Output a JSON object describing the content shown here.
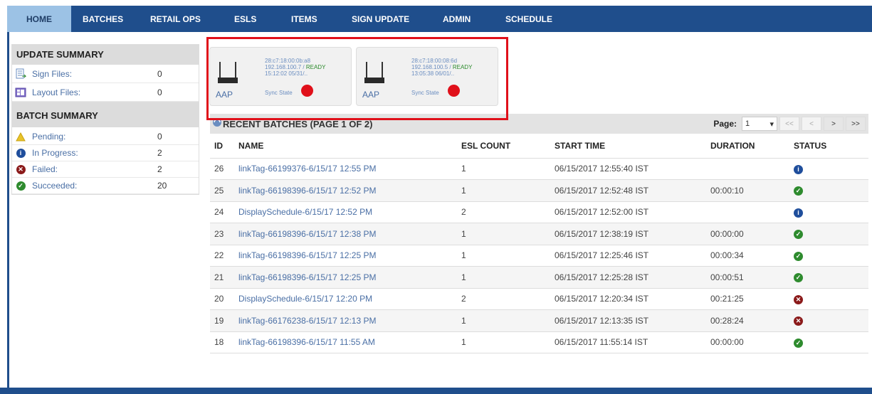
{
  "nav": {
    "items": [
      "HOME",
      "BATCHES",
      "RETAIL OPS",
      "ESLS",
      "ITEMS",
      "SIGN UPDATE",
      "ADMIN",
      "SCHEDULE"
    ],
    "active_index": 0
  },
  "update_summary": {
    "title": "UPDATE SUMMARY",
    "rows": [
      {
        "label": "Sign Files:",
        "value": "0",
        "icon": "sign-file-icon"
      },
      {
        "label": "Layout Files:",
        "value": "0",
        "icon": "layout-file-icon"
      }
    ]
  },
  "batch_summary": {
    "title": "BATCH SUMMARY",
    "rows": [
      {
        "label": "Pending:",
        "value": "0",
        "icon": "warning-icon",
        "color": "#e8c32a"
      },
      {
        "label": "In Progress:",
        "value": "2",
        "icon": "info-icon",
        "color": "#1f4e9c"
      },
      {
        "label": "Failed:",
        "value": "2",
        "icon": "error-icon",
        "color": "#8b1a1a"
      },
      {
        "label": "Succeeded:",
        "value": "20",
        "icon": "check-icon",
        "color": "#2e8b2e"
      }
    ]
  },
  "aps": [
    {
      "label": "AAP",
      "mac": "28:c7:18:00:0b:a8",
      "ip": "192.168.100.7 /",
      "status": "READY",
      "time": "15:12:02 05/31/..",
      "sync": "Sync State"
    },
    {
      "label": "AAP",
      "mac": "28:c7:18:00:08:6d",
      "ip": "192.168.100.5 /",
      "status": "READY",
      "time": "13:05:38 06/01/..",
      "sync": "Sync State"
    }
  ],
  "batches": {
    "title": "RECENT BATCHES (PAGE 1 OF 2)",
    "page_label": "Page:",
    "page_value": "1",
    "pager_buttons": [
      "<<",
      "<",
      ">",
      ">>"
    ],
    "columns": [
      "ID",
      "NAME",
      "ESL COUNT",
      "START TIME",
      "DURATION",
      "STATUS"
    ],
    "rows": [
      {
        "id": "26",
        "name": "linkTag-66199376-6/15/17 12:55 PM",
        "count": "1",
        "start": "06/15/2017 12:55:40 IST",
        "duration": "",
        "status": "info"
      },
      {
        "id": "25",
        "name": "linkTag-66198396-6/15/17 12:52 PM",
        "count": "1",
        "start": "06/15/2017 12:52:48 IST",
        "duration": "00:00:10",
        "status": "success"
      },
      {
        "id": "24",
        "name": "DisplaySchedule-6/15/17 12:52 PM",
        "count": "2",
        "start": "06/15/2017 12:52:00 IST",
        "duration": "",
        "status": "info"
      },
      {
        "id": "23",
        "name": "linkTag-66198396-6/15/17 12:38 PM",
        "count": "1",
        "start": "06/15/2017 12:38:19 IST",
        "duration": "00:00:00",
        "status": "success"
      },
      {
        "id": "22",
        "name": "linkTag-66198396-6/15/17 12:25 PM",
        "count": "1",
        "start": "06/15/2017 12:25:46 IST",
        "duration": "00:00:34",
        "status": "success"
      },
      {
        "id": "21",
        "name": "linkTag-66198396-6/15/17 12:25 PM",
        "count": "1",
        "start": "06/15/2017 12:25:28 IST",
        "duration": "00:00:51",
        "status": "success"
      },
      {
        "id": "20",
        "name": "DisplaySchedule-6/15/17 12:20 PM",
        "count": "2",
        "start": "06/15/2017 12:20:34 IST",
        "duration": "00:21:25",
        "status": "failed"
      },
      {
        "id": "19",
        "name": "linkTag-66176238-6/15/17 12:13 PM",
        "count": "1",
        "start": "06/15/2017 12:13:35 IST",
        "duration": "00:28:24",
        "status": "failed"
      },
      {
        "id": "18",
        "name": "linkTag-66198396-6/15/17 11:55 AM",
        "count": "1",
        "start": "06/15/2017 11:55:14 IST",
        "duration": "00:00:00",
        "status": "success"
      }
    ]
  },
  "status_colors": {
    "info": "#1f4e9c",
    "success": "#2e8b2e",
    "failed": "#8b1a1a"
  }
}
